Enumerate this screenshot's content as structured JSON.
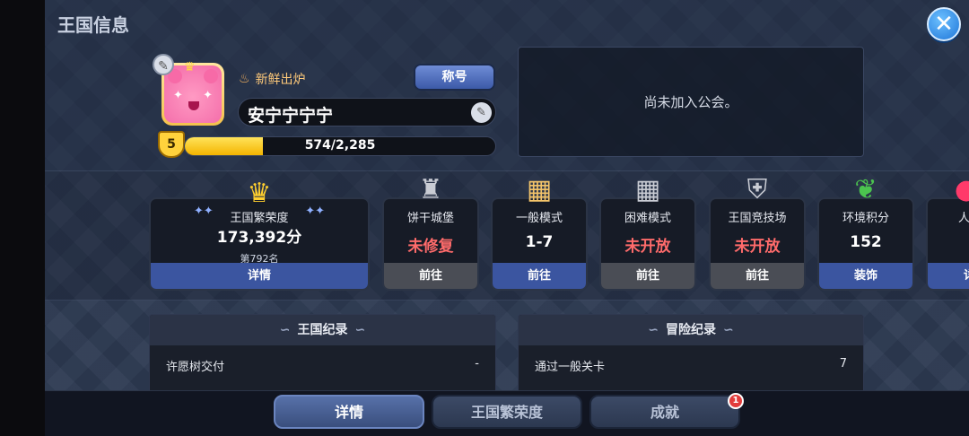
{
  "header": {
    "title": "王国信息"
  },
  "profile": {
    "badge_title": "新鲜出炉",
    "title_button": "称号",
    "name": "安宁宁宁宁",
    "level": "5",
    "exp_text": "574/2,285",
    "exp_fraction": 0.251
  },
  "guild": {
    "status": "尚未加入公会。"
  },
  "cards": [
    {
      "label": "王国繁荣度",
      "value": "173,392分",
      "sub": "第792名",
      "button": "详情",
      "icon": "crown-gem-icon"
    },
    {
      "label": "饼干城堡",
      "value": "未修复",
      "button": "前往",
      "icon": "castle-icon"
    },
    {
      "label": "一般模式",
      "value": "1-7",
      "button": "前往",
      "icon": "map-icon"
    },
    {
      "label": "困难模式",
      "value": "未开放",
      "button": "前往",
      "icon": "hard-map-icon"
    },
    {
      "label": "王国竞技场",
      "value": "未开放",
      "button": "前往",
      "icon": "arena-shield-icon"
    },
    {
      "label": "环境积分",
      "value": "152",
      "button": "装饰",
      "icon": "sprout-icon"
    },
    {
      "label": "人",
      "button": "详",
      "icon": "heart-gem-icon"
    }
  ],
  "records": {
    "kingdom": {
      "title": "王国纪录",
      "rows": [
        {
          "label": "许愿树交付",
          "value": "-"
        }
      ]
    },
    "adventure": {
      "title": "冒险纪录",
      "rows": [
        {
          "label": "通过一般关卡",
          "value": "7"
        }
      ]
    }
  },
  "tabs": [
    {
      "label": "详情",
      "active": true
    },
    {
      "label": "王国繁荣度",
      "active": false
    },
    {
      "label": "成就",
      "active": false,
      "badge": "1"
    }
  ],
  "colors": {
    "accent_blue": "#3b55a0",
    "locked_red": "#ff6b6b",
    "exp_yellow": "#f4b400"
  }
}
